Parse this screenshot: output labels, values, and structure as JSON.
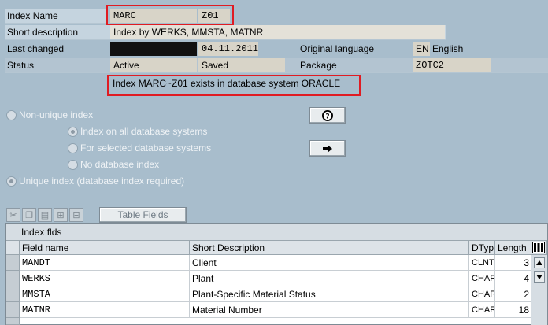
{
  "header": {
    "index_name_label": "Index Name",
    "table_name": "MARC",
    "index_id": "Z01",
    "short_desc_label": "Short description",
    "short_desc_value": "Index by WERKS, MMSTA, MATNR",
    "last_changed_label": "Last changed",
    "last_changed_user": "",
    "last_changed_date": "04.11.2011",
    "orig_lang_label": "Original language",
    "orig_lang_code": "EN",
    "orig_lang_name": "English",
    "status_label": "Status",
    "status_value": "Active",
    "status_saved": "Saved",
    "package_label": "Package",
    "package_value": "ZOTC2",
    "db_message": "Index MARC~Z01 exists in database system ORACLE"
  },
  "options": {
    "non_unique": "Non-unique index",
    "all_db": "Index on all database systems",
    "selected_db": "For selected database systems",
    "no_db": "No database index",
    "unique": "Unique index (database index required)"
  },
  "toolbar": {
    "table_fields": "Table Fields"
  },
  "grid": {
    "title": "Index flds",
    "columns": [
      "Field name",
      "Short Description",
      "DTyp",
      "Length"
    ],
    "rows": [
      {
        "field": "MANDT",
        "desc": "Client",
        "dtyp": "CLNT",
        "length": "3"
      },
      {
        "field": "WERKS",
        "desc": "Plant",
        "dtyp": "CHAR",
        "length": "4"
      },
      {
        "field": "MMSTA",
        "desc": "Plant-Specific Material Status",
        "dtyp": "CHAR",
        "length": "2"
      },
      {
        "field": "MATNR",
        "desc": "Material Number",
        "dtyp": "CHAR",
        "length": "18"
      }
    ]
  },
  "colors": {
    "background": "#a8bdcc",
    "highlight": "#e01b22"
  }
}
